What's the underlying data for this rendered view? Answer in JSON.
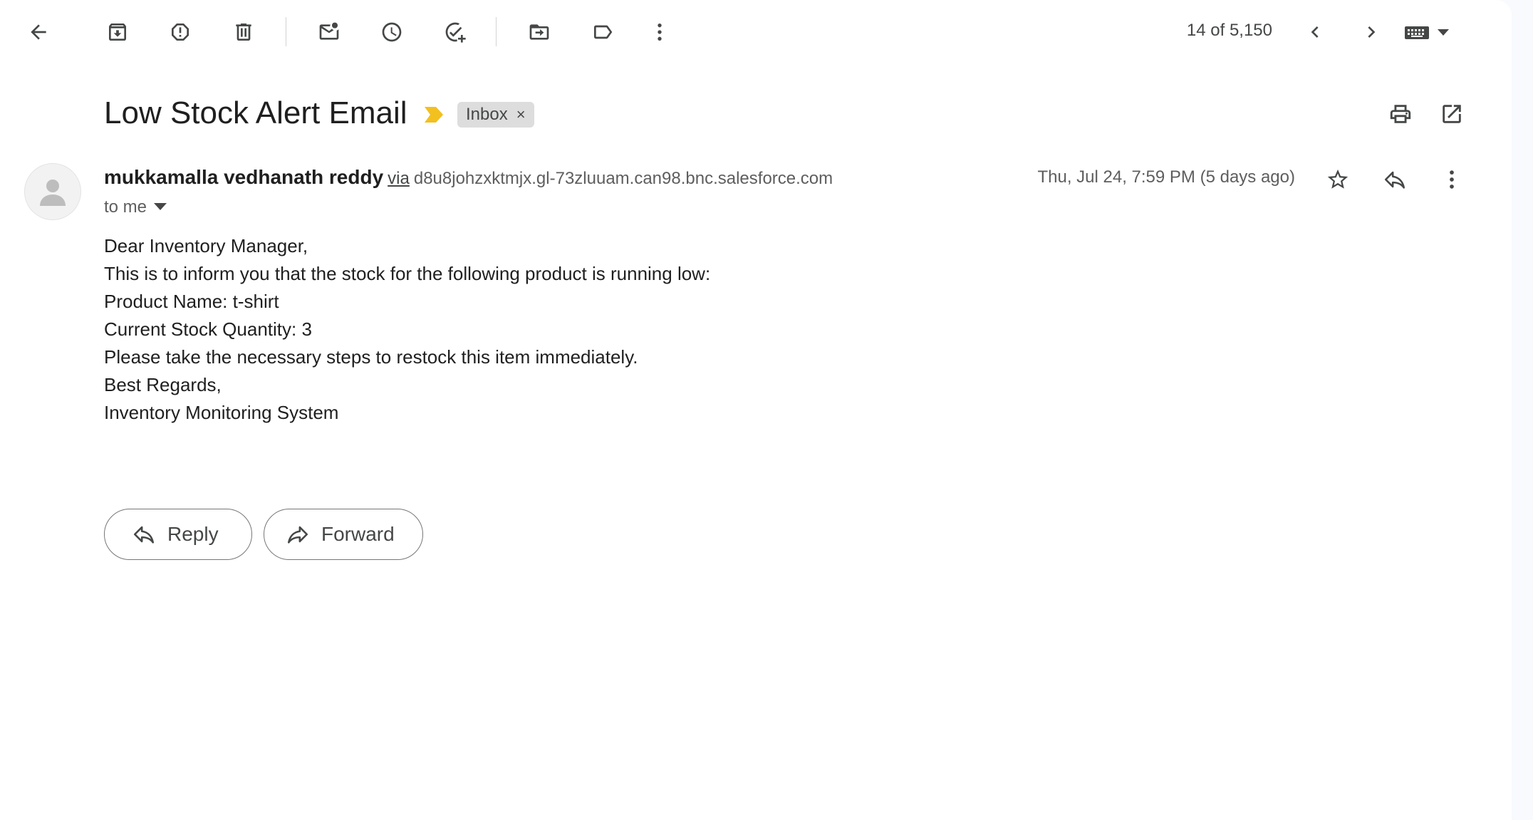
{
  "toolbar": {
    "counter": "14 of 5,150"
  },
  "message": {
    "subject": "Low Stock Alert Email",
    "label": "Inbox",
    "label_remove": "×",
    "sender_name": "mukkamalla vedhanath reddy",
    "via": "via",
    "via_domain": "d8u8johzxktmjx.gl-73zluuam.can98.bnc.salesforce.com",
    "recipients": "to me",
    "date": "Thu, Jul 24, 7:59 PM (5 days ago)",
    "body": [
      "Dear Inventory Manager,",
      "This is to inform you that the stock for the following product is running low:",
      "Product Name: t-shirt",
      "Current Stock Quantity: 3",
      "Please take the necessary steps to restock this item immediately.",
      "Best Regards,",
      "Inventory Monitoring System"
    ]
  },
  "actions": {
    "reply": "Reply",
    "forward": "Forward"
  },
  "colors": {
    "importance": "#f2c01f",
    "label_bg": "#dddddd",
    "icon": "#444746"
  }
}
